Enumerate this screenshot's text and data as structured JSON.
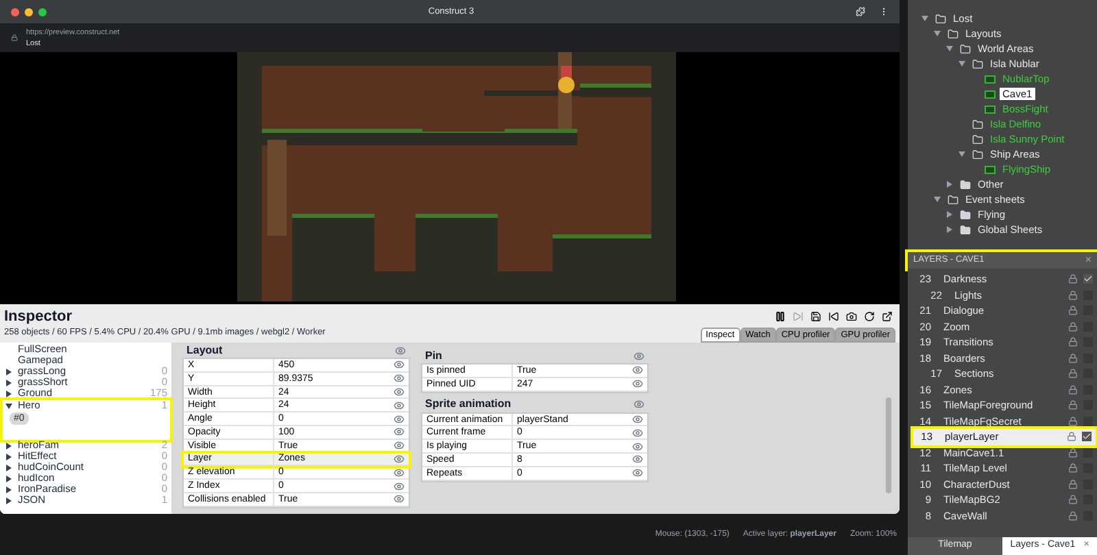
{
  "browser": {
    "title": "Construct 3",
    "url": "https://preview.construct.net",
    "page_title": "Lost"
  },
  "inspector": {
    "title": "Inspector",
    "stats": "258 objects / 60 FPS / 5.4% CPU / 20.4% GPU / 9.1mb images / webgl2 / Worker",
    "tabs": [
      {
        "label": "Inspect",
        "selected": true
      },
      {
        "label": "Watch",
        "selected": false
      },
      {
        "label": "CPU profiler",
        "selected": false
      },
      {
        "label": "GPU profiler",
        "selected": false
      }
    ],
    "objects": [
      {
        "name": "FullScreen",
        "kind": "plain"
      },
      {
        "name": "Gamepad",
        "kind": "plain"
      },
      {
        "name": "grassLong",
        "count": "0",
        "kind": "type",
        "expanded": false,
        "highlighted": false
      },
      {
        "name": "grassShort",
        "count": "0",
        "kind": "type",
        "expanded": false,
        "highlighted": false
      },
      {
        "name": "Ground",
        "count": "175",
        "kind": "type",
        "expanded": false,
        "highlighted": false
      },
      {
        "name": "Hero",
        "count": "1",
        "kind": "type",
        "expanded": true,
        "highlighted": true,
        "instances": [
          {
            "label": "#0",
            "selected": true
          }
        ]
      },
      {
        "name": "heroFam",
        "count": "2",
        "kind": "type",
        "expanded": false,
        "highlighted": false
      },
      {
        "name": "HitEffect",
        "count": "0",
        "kind": "type",
        "expanded": false,
        "highlighted": false
      },
      {
        "name": "hudCoinCount",
        "count": "0",
        "kind": "type",
        "expanded": false,
        "highlighted": false
      },
      {
        "name": "hudIcon",
        "count": "0",
        "kind": "type",
        "expanded": false,
        "highlighted": false
      },
      {
        "name": "IronParadise",
        "count": "0",
        "kind": "type",
        "expanded": false,
        "highlighted": false
      },
      {
        "name": "JSON",
        "count": "1",
        "kind": "type",
        "expanded": false,
        "highlighted": false
      }
    ],
    "sections": [
      {
        "title": "Layout",
        "rows": [
          {
            "name": "X",
            "value": "450",
            "highlighted": false
          },
          {
            "name": "Y",
            "value": "89.9375",
            "highlighted": false
          },
          {
            "name": "Width",
            "value": "24",
            "highlighted": false
          },
          {
            "name": "Height",
            "value": "24",
            "highlighted": false
          },
          {
            "name": "Angle",
            "value": "0",
            "highlighted": false
          },
          {
            "name": "Opacity",
            "value": "100",
            "highlighted": false
          },
          {
            "name": "Visible",
            "value": "True",
            "highlighted": false
          },
          {
            "name": "Layer",
            "value": "Zones",
            "highlighted": true
          },
          {
            "name": "Z elevation",
            "value": "0",
            "highlighted": false
          },
          {
            "name": "Z Index",
            "value": "0",
            "highlighted": false
          },
          {
            "name": "Collisions enabled",
            "value": "True",
            "highlighted": false
          }
        ]
      },
      {
        "title": "Pin",
        "rows": [
          {
            "name": "Is pinned",
            "value": "True",
            "highlighted": false
          },
          {
            "name": "Pinned UID",
            "value": "247",
            "highlighted": false
          }
        ]
      },
      {
        "title": "Sprite animation",
        "rows": [
          {
            "name": "Current animation",
            "value": "playerStand",
            "highlighted": false
          },
          {
            "name": "Current frame",
            "value": "0",
            "highlighted": false
          },
          {
            "name": "Is playing",
            "value": "True",
            "highlighted": false
          },
          {
            "name": "Speed",
            "value": "8",
            "highlighted": false
          },
          {
            "name": "Repeats",
            "value": "0",
            "highlighted": false
          }
        ]
      }
    ]
  },
  "status_bar": {
    "mouse": "Mouse: (1303, -175)",
    "active_layer": "Active layer: **playerLayer**",
    "zoom": "Zoom: 100%"
  },
  "project_tree": [
    {
      "name": "Lost",
      "kind": "folder",
      "expanded": true,
      "selected": false,
      "children": [
        {
          "name": "Layouts",
          "kind": "folder",
          "expanded": true,
          "selected": false,
          "children": [
            {
              "name": "World Areas",
              "kind": "folder",
              "expanded": true,
              "selected": false,
              "children": [
                {
                  "name": "Isla Nublar",
                  "kind": "folder",
                  "expanded": true,
                  "selected": false,
                  "children": [
                    {
                      "name": "NublarTop",
                      "kind": "layout",
                      "selected": false
                    },
                    {
                      "name": "Cave1",
                      "kind": "layout",
                      "selected": true
                    },
                    {
                      "name": "BossFight",
                      "kind": "layout",
                      "selected": false
                    }
                  ]
                },
                {
                  "name": "Isla Delfino",
                  "kind": "folder",
                  "empty": true,
                  "selected": false
                },
                {
                  "name": "Isla Sunny Point",
                  "kind": "folder",
                  "empty": true,
                  "selected": false
                },
                {
                  "name": "Ship Areas",
                  "kind": "folder",
                  "expanded": true,
                  "selected": false,
                  "children": [
                    {
                      "name": "FlyingShip",
                      "kind": "layout",
                      "selected": false
                    }
                  ]
                }
              ]
            },
            {
              "name": "Other",
              "kind": "folder",
              "expanded": false,
              "selected": false
            }
          ]
        },
        {
          "name": "Event sheets",
          "kind": "folder",
          "expanded": true,
          "selected": false,
          "children": [
            {
              "name": "Flying",
              "kind": "folder",
              "expanded": false,
              "selected": false
            },
            {
              "name": "Global Sheets",
              "kind": "folder",
              "expanded": false,
              "selected": false
            }
          ]
        }
      ]
    }
  ],
  "layers_panel": {
    "title": "LAYERS - CAVE1",
    "close": "×",
    "highlighted": true,
    "layers": [
      {
        "number": "23",
        "name": "Darkness",
        "visible": true,
        "highlighted": false,
        "children": [
          {
            "number": "22",
            "name": "Lights",
            "visible": false,
            "highlighted": false
          }
        ]
      },
      {
        "number": "21",
        "name": "Dialogue",
        "visible": false,
        "highlighted": false
      },
      {
        "number": "20",
        "name": "Zoom",
        "visible": false,
        "highlighted": false
      },
      {
        "number": "19",
        "name": "Transitions",
        "visible": false,
        "highlighted": false
      },
      {
        "number": "18",
        "name": "Boarders",
        "visible": false,
        "highlighted": false,
        "children": [
          {
            "number": "17",
            "name": "Sections",
            "visible": false,
            "highlighted": false
          }
        ]
      },
      {
        "number": "16",
        "name": "Zones",
        "visible": false,
        "highlighted": false
      },
      {
        "number": "15",
        "name": "TileMapForeground",
        "visible": false,
        "highlighted": false
      },
      {
        "number": "14",
        "name": "TileMapFgSecret",
        "visible": false,
        "highlighted": false
      },
      {
        "number": "13",
        "name": "playerLayer",
        "visible": true,
        "highlighted": true
      },
      {
        "number": "12",
        "name": "MainCave1.1",
        "visible": false,
        "highlighted": false
      },
      {
        "number": "11",
        "name": "TileMap Level",
        "visible": false,
        "highlighted": false
      },
      {
        "number": "10",
        "name": "CharacterDust",
        "visible": false,
        "highlighted": false
      },
      {
        "number": "9",
        "name": "TileMapBG2",
        "visible": false,
        "highlighted": false
      },
      {
        "number": "8",
        "name": "CaveWall",
        "visible": false,
        "highlighted": false
      }
    ]
  },
  "bottom_tabs": [
    {
      "label": "Tilemap",
      "selected": false
    },
    {
      "label": "Layers - Cave1",
      "selected": true,
      "close": "×"
    }
  ]
}
